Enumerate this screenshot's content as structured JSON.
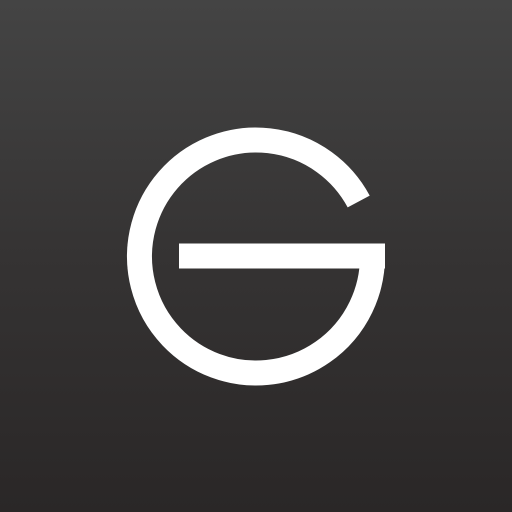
{
  "app_icon": {
    "icon": "letter-g-logo-icon",
    "background_top": "#444444",
    "background_bottom": "#2a2727",
    "logo_color": "#ffffff"
  }
}
